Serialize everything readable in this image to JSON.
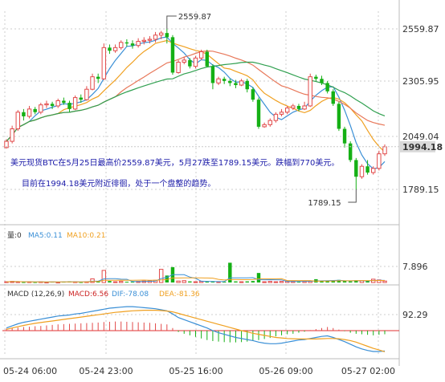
{
  "chart_data": {
    "type": "candlestick",
    "price_axis": {
      "ticks": [
        "2559.87",
        "2305.95",
        "2049.04",
        "1789.15"
      ],
      "tick_values": [
        2559.87,
        2305.95,
        2049.04,
        1789.15
      ],
      "current_price": "1994.18",
      "current_value": 1994.18,
      "ylim": [
        1730,
        2640
      ]
    },
    "x_axis": {
      "labels": [
        "05-24 06:00",
        "05-24 23:00",
        "05-25 16:00",
        "05-26 09:00",
        "05-27 02:00"
      ],
      "label_index": [
        0,
        14,
        29,
        44,
        59
      ]
    },
    "peak_label": "2559.87",
    "peak_value": 2559.87,
    "trough_label": "1789.15",
    "trough_value": 1789.15,
    "annotations": [
      "美元现货BTC在5月25日最高价2559.87美元，5月27跌至1789.15美元。跌幅到770美元。",
      "目前在1994.18美元附近徘徊，处于一个盘整的趋势。"
    ],
    "volume_legend": {
      "label": "量:0",
      "ma5": "MA5:0.11",
      "ma10": "MA10:0.21"
    },
    "volume_axis": {
      "tick": "7.896",
      "tick_value": 7.896
    },
    "macd_legend": {
      "label": "MACD (12,26,9)",
      "macd": "MACD:6.56",
      "dif": "DIF:-78.08",
      "dea": "DEA:-81.36"
    },
    "macd_axis": {
      "tick": "92.29",
      "tick_value": 92.29
    },
    "colors": {
      "up": "#e24a4a",
      "down": "#15b015",
      "ma5": "#3a8fd6",
      "ma10": "#f0a020",
      "ma20": "#e8785a",
      "ma30": "#30a050"
    },
    "candles": [
      [
        1990,
        2020,
        1985,
        2030
      ],
      [
        2020,
        2080,
        2010,
        2095
      ],
      [
        2080,
        2160,
        2070,
        2170
      ],
      [
        2160,
        2140,
        2120,
        2175
      ],
      [
        2140,
        2175,
        2130,
        2190
      ],
      [
        2175,
        2160,
        2150,
        2185
      ],
      [
        2160,
        2195,
        2150,
        2205
      ],
      [
        2195,
        2200,
        2180,
        2215
      ],
      [
        2200,
        2190,
        2175,
        2210
      ],
      [
        2190,
        2215,
        2180,
        2225
      ],
      [
        2215,
        2205,
        2195,
        2230
      ],
      [
        2205,
        2175,
        2160,
        2215
      ],
      [
        2175,
        2230,
        2170,
        2240
      ],
      [
        2230,
        2220,
        2205,
        2245
      ],
      [
        2220,
        2270,
        2215,
        2285
      ],
      [
        2270,
        2330,
        2265,
        2345
      ],
      [
        2330,
        2320,
        2300,
        2345
      ],
      [
        2320,
        2470,
        2315,
        2490
      ],
      [
        2470,
        2455,
        2440,
        2485
      ],
      [
        2455,
        2470,
        2445,
        2485
      ],
      [
        2470,
        2495,
        2460,
        2505
      ],
      [
        2495,
        2490,
        2475,
        2510
      ],
      [
        2490,
        2480,
        2465,
        2505
      ],
      [
        2480,
        2500,
        2470,
        2515
      ],
      [
        2500,
        2505,
        2485,
        2520
      ],
      [
        2505,
        2510,
        2490,
        2525
      ],
      [
        2510,
        2530,
        2495,
        2545
      ],
      [
        2530,
        2540,
        2510,
        2550
      ],
      [
        2540,
        2520,
        2490,
        2560
      ],
      [
        2520,
        2350,
        2340,
        2530
      ],
      [
        2350,
        2400,
        2345,
        2410
      ],
      [
        2400,
        2410,
        2390,
        2425
      ],
      [
        2410,
        2380,
        2370,
        2420
      ],
      [
        2380,
        2420,
        2370,
        2430
      ],
      [
        2420,
        2450,
        2410,
        2460
      ],
      [
        2450,
        2380,
        2375,
        2460
      ],
      [
        2380,
        2300,
        2270,
        2390
      ],
      [
        2300,
        2320,
        2290,
        2330
      ],
      [
        2320,
        2310,
        2295,
        2330
      ],
      [
        2310,
        2300,
        2285,
        2320
      ],
      [
        2300,
        2290,
        2275,
        2315
      ],
      [
        2290,
        2310,
        2285,
        2320
      ],
      [
        2310,
        2270,
        2255,
        2320
      ],
      [
        2270,
        2220,
        2210,
        2280
      ],
      [
        2220,
        2090,
        2080,
        2230
      ],
      [
        2090,
        2100,
        2085,
        2110
      ],
      [
        2100,
        2120,
        2090,
        2130
      ],
      [
        2120,
        2150,
        2110,
        2160
      ],
      [
        2150,
        2160,
        2140,
        2175
      ],
      [
        2160,
        2180,
        2150,
        2190
      ],
      [
        2180,
        2190,
        2170,
        2200
      ],
      [
        2190,
        2175,
        2165,
        2200
      ],
      [
        2175,
        2190,
        2170,
        2210
      ],
      [
        2190,
        2330,
        2185,
        2345
      ],
      [
        2330,
        2320,
        2310,
        2340
      ],
      [
        2320,
        2300,
        2290,
        2335
      ],
      [
        2300,
        2260,
        2250,
        2310
      ],
      [
        2260,
        2200,
        2190,
        2270
      ],
      [
        2200,
        2080,
        2070,
        2210
      ],
      [
        2080,
        2010,
        1990,
        2090
      ],
      [
        2010,
        1930,
        1920,
        2020
      ],
      [
        1930,
        1850,
        1789,
        1940
      ],
      [
        1850,
        1900,
        1840,
        1910
      ],
      [
        1900,
        1870,
        1860,
        1930
      ],
      [
        1870,
        1890,
        1860,
        1900
      ],
      [
        1890,
        1960,
        1880,
        1975
      ],
      [
        1960,
        1994,
        1950,
        2005
      ]
    ],
    "volume": [
      0.2,
      0.3,
      0.2,
      0.1,
      0.2,
      0.1,
      0.2,
      0.1,
      0.2,
      0.1,
      0.2,
      0.3,
      0.2,
      0.1,
      0.2,
      1.0,
      0.3,
      3.3,
      0.4,
      0.2,
      0.3,
      0.2,
      0.2,
      0.3,
      0.4,
      0.5,
      0.6,
      3.6,
      1.9,
      4.2,
      0.4,
      0.5,
      0.3,
      0.2,
      0.3,
      0.2,
      0.3,
      0.2,
      0.2,
      5.4,
      0.3,
      0.2,
      0.3,
      0.4,
      2.6,
      0.2,
      0.3,
      0.2,
      0.3,
      0.4,
      0.3,
      0.2,
      0.3,
      0.4,
      0.9,
      0.5,
      0.4,
      0.5,
      0.7,
      0.4,
      0.3,
      0.6,
      0.5,
      0.4,
      0.9,
      0.7,
      0.4
    ],
    "macd_hist": [
      8,
      10,
      12,
      14,
      15,
      17,
      18,
      20,
      22,
      24,
      25,
      26,
      27,
      28,
      29,
      30,
      31,
      33,
      34,
      35,
      35,
      34,
      33,
      32,
      31,
      30,
      28,
      26,
      24,
      10,
      -5,
      -12,
      -18,
      -24,
      -30,
      -36,
      -40,
      -42,
      -44,
      -45,
      -45,
      -44,
      -42,
      -40,
      -36,
      -32,
      -28,
      -22,
      -18,
      -14,
      -12,
      -8,
      -4,
      2,
      6,
      10,
      14,
      10,
      4,
      -2,
      -8,
      -12,
      -14,
      -16,
      -18,
      -16,
      -14
    ],
    "macd_dif": [
      10,
      18,
      26,
      32,
      36,
      40,
      44,
      48,
      52,
      56,
      58,
      60,
      64,
      66,
      70,
      74,
      78,
      82,
      86,
      88,
      90,
      92,
      92,
      90,
      88,
      86,
      84,
      80,
      76,
      64,
      50,
      42,
      34,
      26,
      18,
      10,
      0,
      -8,
      -14,
      -20,
      -26,
      -30,
      -34,
      -38,
      -44,
      -48,
      -50,
      -50,
      -48,
      -44,
      -40,
      -36,
      -34,
      -30,
      -26,
      -22,
      -20,
      -26,
      -34,
      -42,
      -52,
      -62,
      -70,
      -76,
      -80,
      -80,
      -78
    ],
    "macd_dea": [
      5,
      10,
      15,
      20,
      24,
      28,
      31,
      34,
      37,
      40,
      43,
      46,
      49,
      52,
      55,
      58,
      61,
      64,
      67,
      70,
      72,
      74,
      76,
      77,
      78,
      78,
      78,
      77,
      75,
      72,
      66,
      60,
      54,
      48,
      42,
      36,
      30,
      24,
      18,
      12,
      6,
      0,
      -5,
      -10,
      -14,
      -18,
      -22,
      -26,
      -28,
      -30,
      -31,
      -32,
      -32,
      -32,
      -32,
      -31,
      -30,
      -30,
      -31,
      -34,
      -38,
      -44,
      -52,
      -60,
      -68,
      -74,
      -81
    ]
  }
}
